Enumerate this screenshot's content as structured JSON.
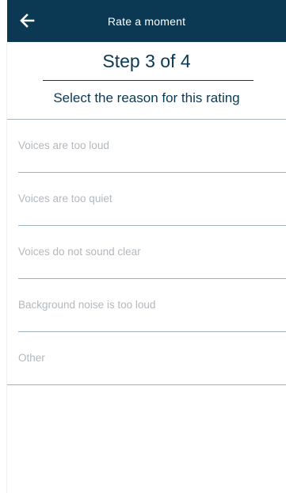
{
  "header": {
    "back_icon": "arrow-left-icon",
    "title": "Rate a moment"
  },
  "step": {
    "title": "Step 3 of 4",
    "subtitle": "Select the reason for this rating"
  },
  "reasons": [
    {
      "label": "Voices are too loud"
    },
    {
      "label": "Voices are too quiet"
    },
    {
      "label": "Voices do not sound clear"
    },
    {
      "label": "Background noise is too loud"
    },
    {
      "label": "Other"
    }
  ],
  "colors": {
    "header_bg": "#0b3954",
    "text_primary": "#0b3954",
    "option_text": "#b3b8bd",
    "divider": "#9fb2bf"
  }
}
